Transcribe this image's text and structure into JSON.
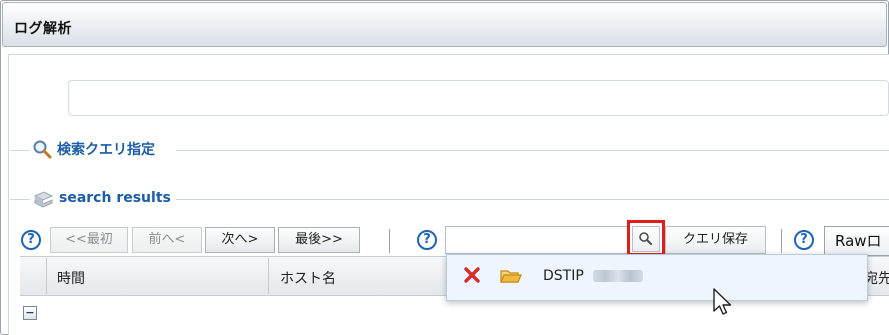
{
  "window": {
    "title": "ログ解析"
  },
  "query": {
    "value": ""
  },
  "sections": {
    "search_query": {
      "label": "検索クエリ指定"
    },
    "search_results": {
      "label": "search results"
    }
  },
  "pager": {
    "first": "<<最初",
    "prev": "前へ<",
    "next": "次へ>",
    "last": "最後>>"
  },
  "help_glyph": "?",
  "search": {
    "value": "",
    "save_label": "クエリ保存"
  },
  "raw_button": {
    "label": "Rawロ"
  },
  "table": {
    "columns": [
      "時間",
      "ホスト名",
      "宛先"
    ],
    "collapse_glyph": "−"
  },
  "saved_query_popup": {
    "items": [
      {
        "text": "DSTIP"
      }
    ]
  },
  "icons": {
    "magnifier": "magnifier-icon",
    "stack": "stack-icon",
    "delete": "delete-x-icon",
    "folder": "folder-open-icon",
    "cursor": "mouse-pointer-icon"
  },
  "colors": {
    "accent_blue": "#1b5da6",
    "highlight_red": "#e01e1e",
    "delete_red": "#d62b2b",
    "folder_orange": "#e7a227"
  }
}
